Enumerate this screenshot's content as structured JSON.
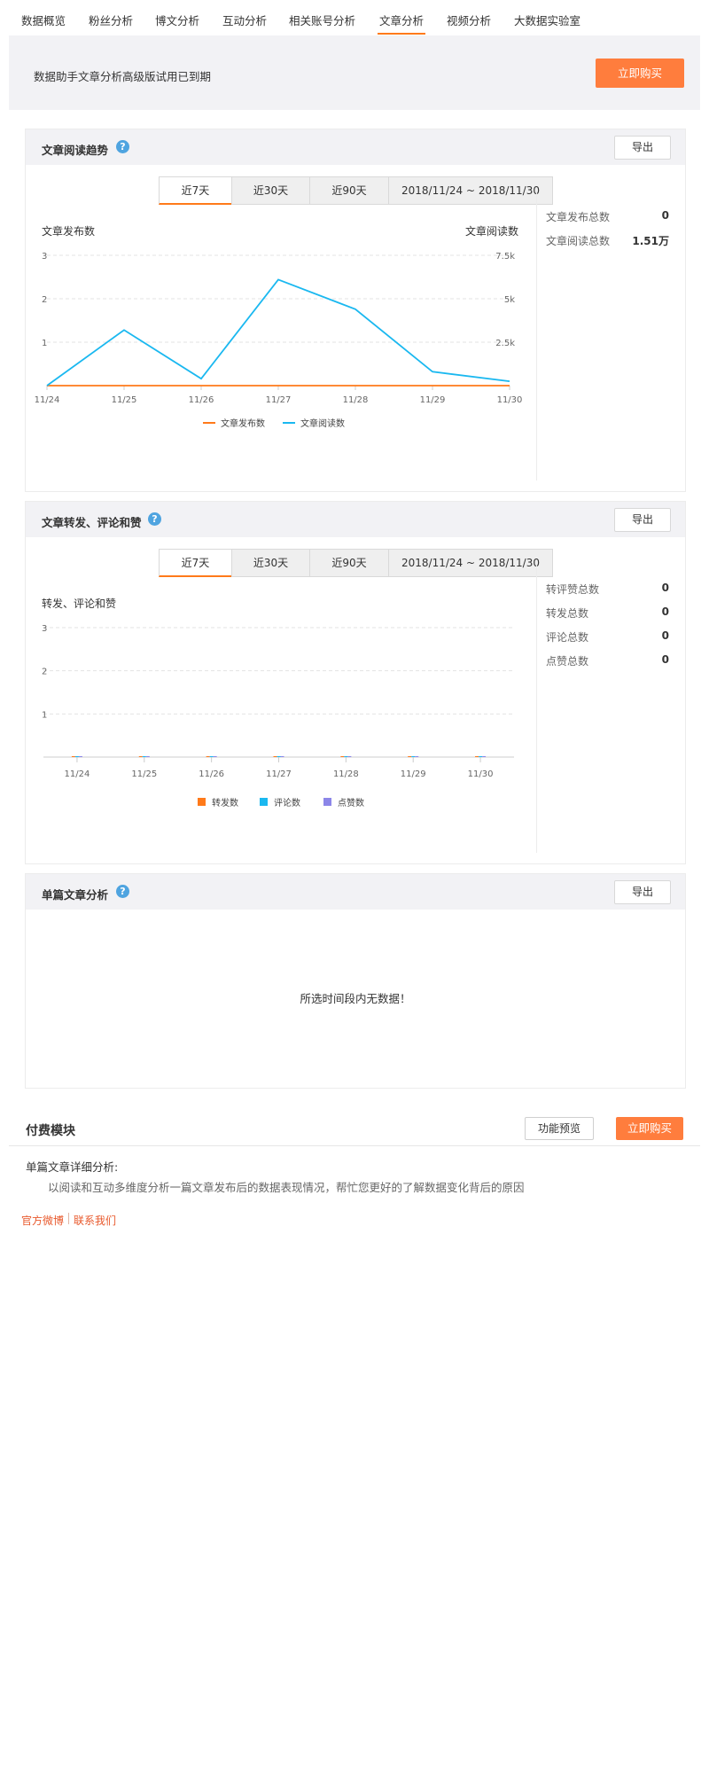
{
  "nav": {
    "items": [
      "数据概览",
      "粉丝分析",
      "博文分析",
      "互动分析",
      "相关账号分析",
      "文章分析",
      "视频分析",
      "大数据实验室"
    ],
    "active_index": 5
  },
  "banner": {
    "text": "数据助手文章分析高级版试用已到期",
    "buy_label": "立即购买"
  },
  "panel1": {
    "title": "文章阅读趋势",
    "help": "?",
    "export": "导出",
    "tabs": [
      "近7天",
      "近30天",
      "近90天",
      "2018/11/24 ~ 2018/11/30"
    ],
    "left_axis_title": "文章发布数",
    "right_axis_title": "文章阅读数",
    "summary": [
      {
        "label": "文章发布总数",
        "value": "0"
      },
      {
        "label": "文章阅读总数",
        "value": "1.51万"
      }
    ]
  },
  "panel2": {
    "title": "文章转发、评论和赞",
    "help": "?",
    "export": "导出",
    "tabs": [
      "近7天",
      "近30天",
      "近90天",
      "2018/11/24 ~ 2018/11/30"
    ],
    "axis_title": "转发、评论和赞",
    "summary": [
      {
        "label": "转评赞总数",
        "value": "0"
      },
      {
        "label": "转发总数",
        "value": "0"
      },
      {
        "label": "评论总数",
        "value": "0"
      },
      {
        "label": "点赞总数",
        "value": "0"
      }
    ]
  },
  "panel3": {
    "title": "单篇文章分析",
    "help": "?",
    "export": "导出",
    "empty_text": "所选时间段内无数据！"
  },
  "paid": {
    "title": "付费模块",
    "preview_label": "功能预览",
    "buy_label": "立即购买",
    "subtitle": "单篇文章详细分析:",
    "description": "以阅读和互动多维度分析一篇文章发布后的数据表现情况，帮忙您更好的了解数据变化背后的原因"
  },
  "footer": {
    "weibo": "官方微博",
    "contact": "联系我们"
  },
  "colors": {
    "accent": "#ff7d3d",
    "line_publish": "#ff7a1a",
    "line_read": "#1ab8f0",
    "bar_comment": "#1ab8f0",
    "bar_like": "#8c86e8",
    "help": "#4fa4e0"
  },
  "chart_data": [
    {
      "type": "line",
      "x": [
        "11/24",
        "11/25",
        "11/26",
        "11/27",
        "11/28",
        "11/29",
        "11/30"
      ],
      "ylim_left": [
        0,
        3
      ],
      "left_ticks": [
        "1",
        "2",
        "3"
      ],
      "ylim_right": [
        0,
        7500
      ],
      "right_ticks": [
        "2.5k",
        "5k",
        "7.5k"
      ],
      "series": [
        {
          "name": "文章发布数",
          "axis": "left",
          "color": "#ff7a1a",
          "values": [
            0,
            0,
            0,
            0,
            0,
            0,
            0
          ]
        },
        {
          "name": "文章阅读数",
          "axis": "right",
          "color": "#1ab8f0",
          "values": [
            0,
            3200,
            400,
            6100,
            4400,
            800,
            250
          ]
        }
      ],
      "legend": "bottom",
      "grid": true
    },
    {
      "type": "bar",
      "categories": [
        "11/24",
        "11/25",
        "11/26",
        "11/27",
        "11/28",
        "11/29",
        "11/30"
      ],
      "ylim": [
        0,
        3
      ],
      "ticks": [
        "1",
        "2",
        "3"
      ],
      "series": [
        {
          "name": "转发数",
          "color": "#ff7a1a",
          "values": [
            0,
            0,
            0,
            0,
            0,
            0,
            0
          ]
        },
        {
          "name": "评论数",
          "color": "#1ab8f0",
          "values": [
            0,
            0,
            0,
            0,
            0,
            0,
            0
          ]
        },
        {
          "name": "点赞数",
          "color": "#8c86e8",
          "values": [
            0,
            0,
            0,
            0,
            0,
            0,
            0
          ]
        }
      ],
      "legend": "bottom",
      "grid": true
    }
  ]
}
